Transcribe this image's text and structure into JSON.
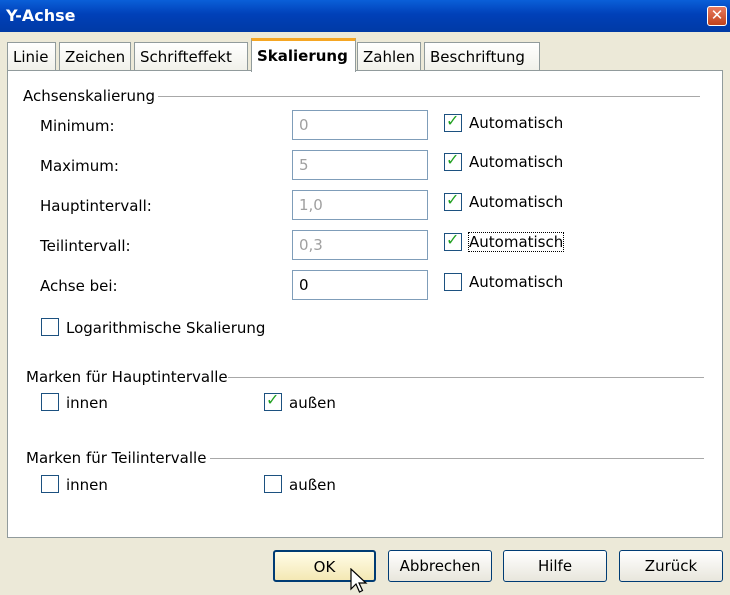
{
  "window": {
    "title": "Y-Achse",
    "close_glyph": "✕"
  },
  "tabs": [
    "Linie",
    "Zeichen",
    "Schrifteffekt",
    "Skalierung",
    "Zahlen",
    "Beschriftung"
  ],
  "active_tab": "Skalierung",
  "axis_scaling": {
    "title": "Achsenskalierung",
    "rows": [
      {
        "label": "Minimum:",
        "value": "0",
        "enabled": false,
        "auto_label": "Automatisch",
        "auto_checked": true
      },
      {
        "label": "Maximum:",
        "value": "5",
        "enabled": false,
        "auto_label": "Automatisch",
        "auto_checked": true
      },
      {
        "label": "Hauptintervall:",
        "value": "1,0",
        "enabled": false,
        "auto_label": "Automatisch",
        "auto_checked": true
      },
      {
        "label": "Teilintervall:",
        "value": "0,3",
        "enabled": false,
        "auto_label": "Automatisch",
        "auto_checked": true
      },
      {
        "label": "Achse bei:",
        "value": "0",
        "enabled": true,
        "auto_label": "Automatisch",
        "auto_checked": false
      }
    ],
    "logarithmic": {
      "label": "Logarithmische Skalierung",
      "checked": false
    }
  },
  "major_marks": {
    "title": "Marken für Hauptintervalle",
    "inner": {
      "label": "innen",
      "checked": false
    },
    "outer": {
      "label": "außen",
      "checked": true
    }
  },
  "minor_marks": {
    "title": "Marken für Teilintervalle",
    "inner": {
      "label": "innen",
      "checked": false
    },
    "outer": {
      "label": "außen",
      "checked": false
    }
  },
  "buttons": {
    "ok": "OK",
    "cancel": "Abbrechen",
    "help": "Hilfe",
    "back": "Zurück"
  },
  "colors": {
    "titlebar": "#0a5fd8",
    "active_tab_accent": "#f5a623",
    "check": "#21a121",
    "dialog_bg": "#ece9d8"
  }
}
